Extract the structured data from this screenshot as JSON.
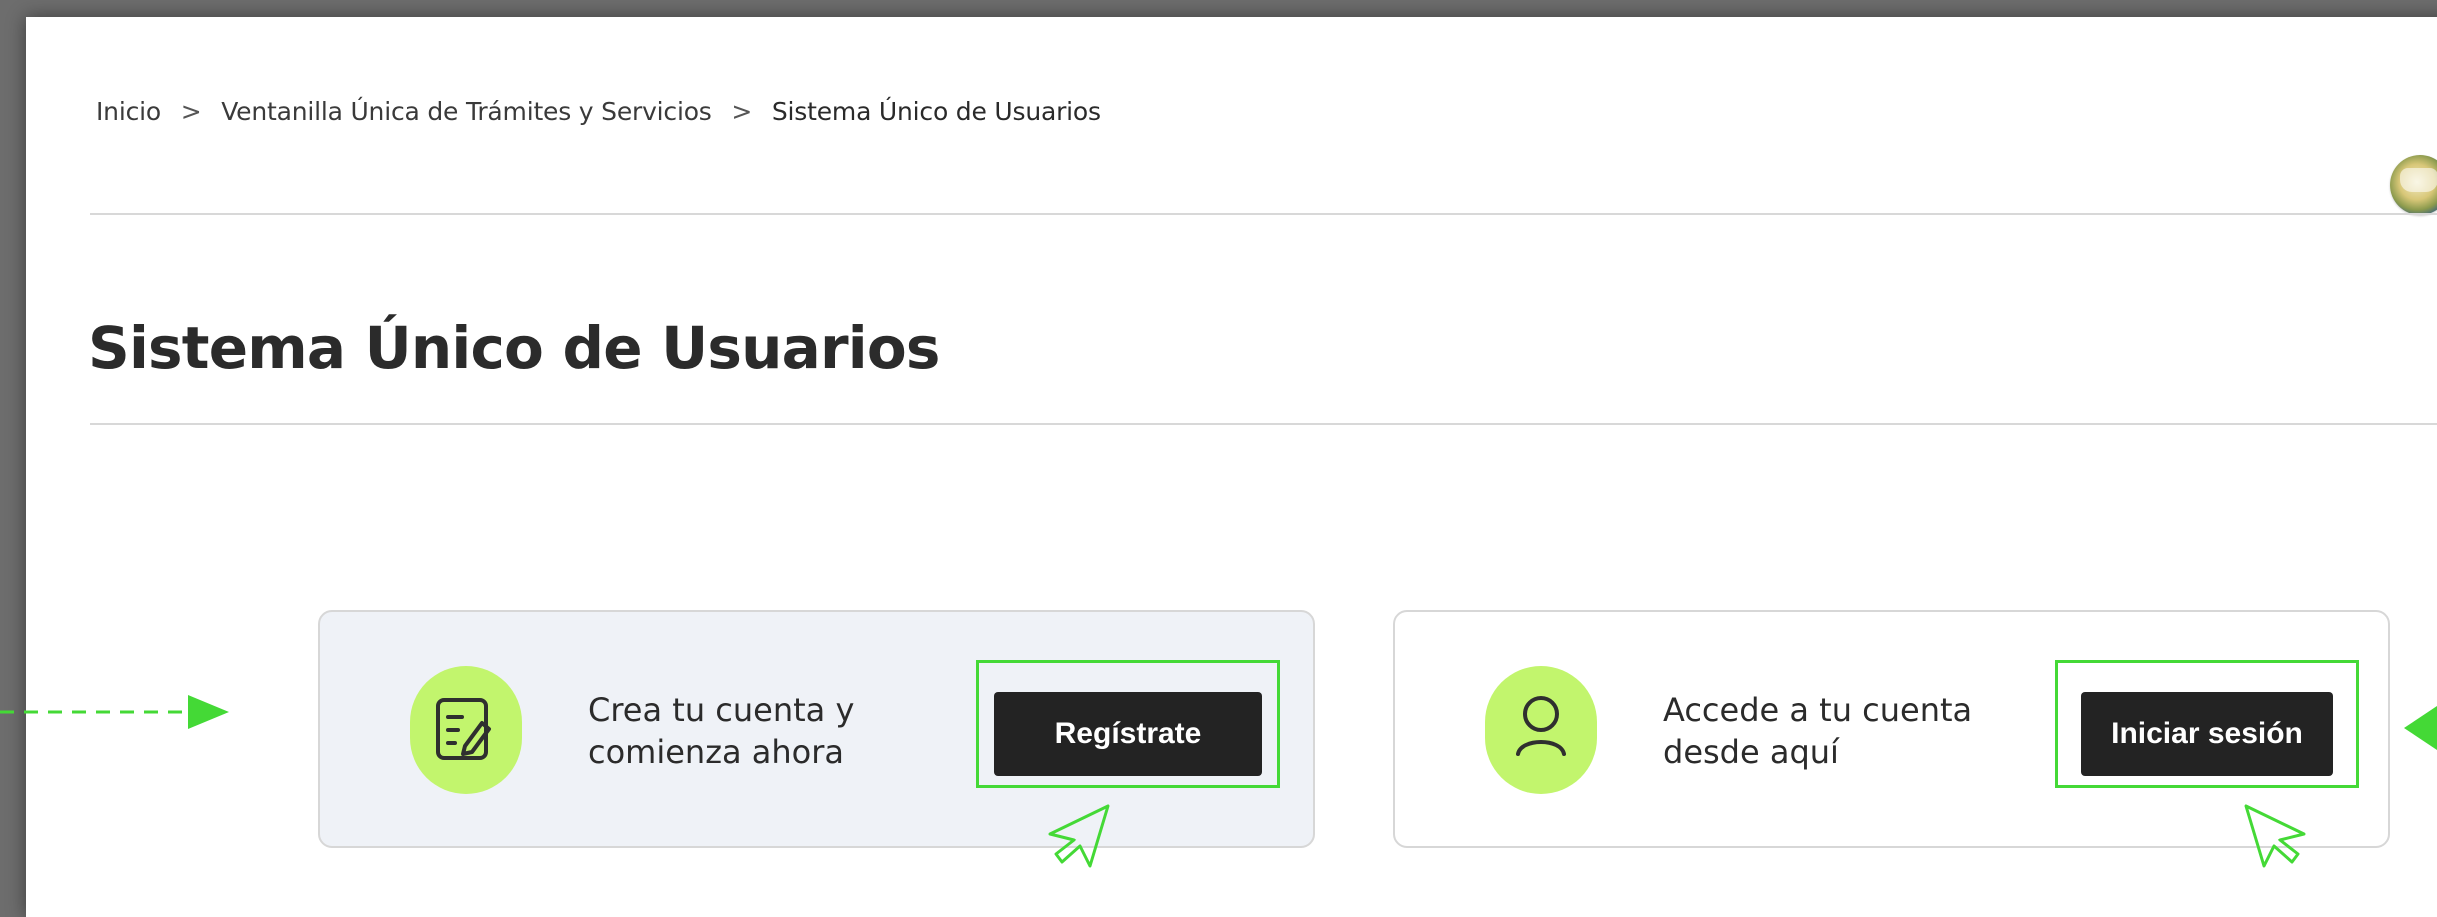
{
  "breadcrumb": {
    "items": [
      "Inicio",
      "Ventanilla Única de Trámites y Servicios",
      "Sistema Único de Usuarios"
    ],
    "separator": ">"
  },
  "page": {
    "title": "Sistema Único de Usuarios"
  },
  "cards": {
    "register": {
      "icon": "edit-form-icon",
      "text_line1": "Crea tu cuenta y",
      "text_line2": "comienza ahora",
      "button_label": "Regístrate",
      "background": "#eff2f7"
    },
    "login": {
      "icon": "user-icon",
      "text_line1": "Accede a tu cuenta",
      "text_line2": "desde aquí",
      "button_label": "Iniciar sesión",
      "background": "#ffffff"
    }
  },
  "colors": {
    "accent": "#c2f56d",
    "highlight": "#44d936",
    "button": "#232323",
    "text": "#2b2b2b",
    "divider": "#d8d8d8"
  }
}
